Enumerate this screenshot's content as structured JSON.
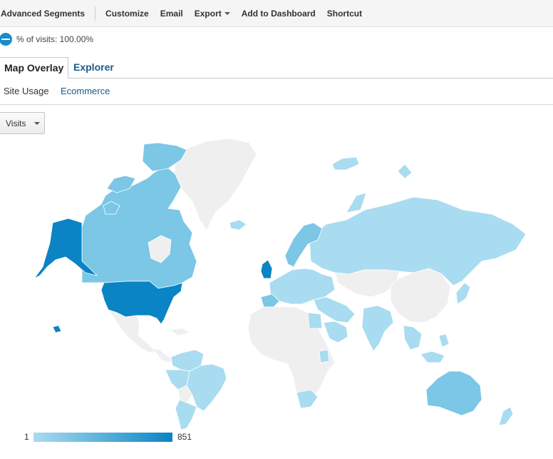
{
  "toolbar": {
    "advanced_segments": "Advanced Segments",
    "customize": "Customize",
    "email": "Email",
    "export": "Export",
    "add_to_dashboard": "Add to Dashboard",
    "shortcut": "Shortcut"
  },
  "segment": {
    "label": "% of visits: 100.00%",
    "percent": 100.0
  },
  "tabs": {
    "map_overlay": "Map Overlay",
    "explorer": "Explorer",
    "active": "Map Overlay"
  },
  "subtabs": {
    "site_usage": "Site Usage",
    "ecommerce": "Ecommerce"
  },
  "metric_select": {
    "selected": "Visits"
  },
  "map": {
    "colors": {
      "none": "#efefef",
      "low": "#a9dcf0",
      "mid": "#7cc6e6",
      "high": "#0a84c4",
      "border": "#ffffff"
    }
  },
  "legend": {
    "min": "1",
    "max": "851",
    "color_min": "#a9dcf0",
    "color_max": "#0a84c4"
  }
}
